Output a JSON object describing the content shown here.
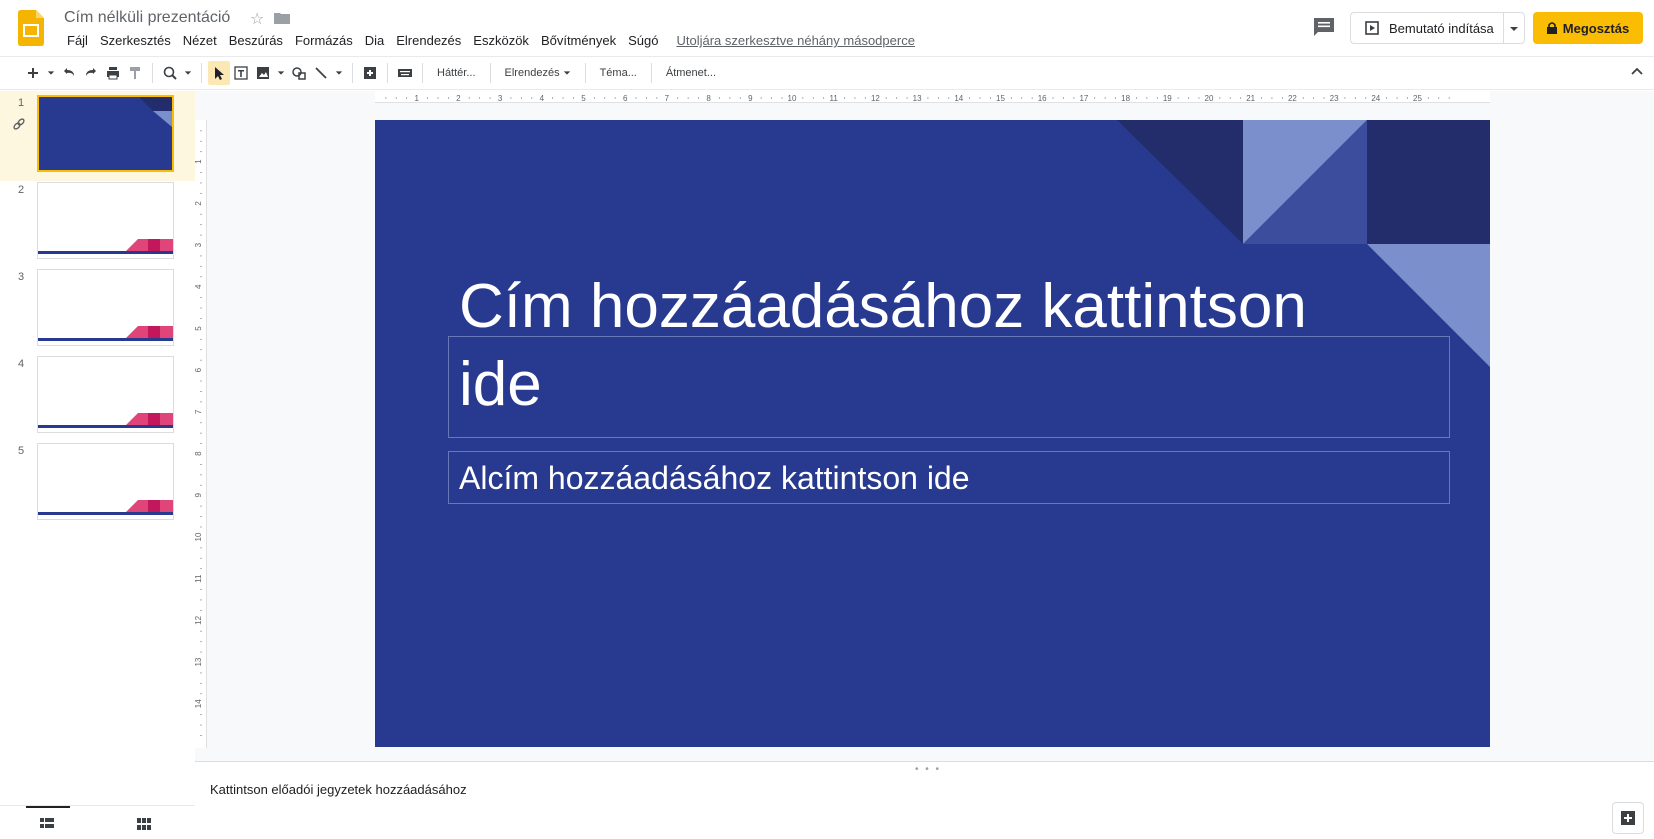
{
  "header": {
    "doc_title": "Cím nélküli prezentáció",
    "menu": [
      "Fájl",
      "Szerkesztés",
      "Nézet",
      "Beszúrás",
      "Formázás",
      "Dia",
      "Elrendezés",
      "Eszközök",
      "Bővítmények",
      "Súgó"
    ],
    "last_edit": "Utoljára szerkesztve néhány másodperce",
    "present_label": "Bemutató indítása",
    "share_label": "Megosztás",
    "accent_color": "#fbbc04"
  },
  "toolbar": {
    "background_label": "Háttér...",
    "layout_label": "Elrendezés",
    "theme_label": "Téma...",
    "transition_label": "Átmenet..."
  },
  "filmstrip": {
    "slides": [
      {
        "number": "1"
      },
      {
        "number": "2"
      },
      {
        "number": "3"
      },
      {
        "number": "4"
      },
      {
        "number": "5"
      }
    ]
  },
  "ruler": {
    "h_ticks": [
      "1",
      "2",
      "3",
      "4",
      "5",
      "6",
      "7",
      "8",
      "9",
      "10",
      "11",
      "12",
      "13",
      "14",
      "15",
      "16",
      "17",
      "18",
      "19",
      "20",
      "21",
      "22",
      "23",
      "24",
      "25"
    ],
    "v_ticks": [
      "1",
      "2",
      "3",
      "4",
      "5",
      "6",
      "7",
      "8",
      "9",
      "10",
      "11",
      "12",
      "13",
      "14"
    ]
  },
  "slide": {
    "title_line1": "Cím hozzáadásához kattintson",
    "title_line2": "ide",
    "subtitle": "Alcím hozzáadásához kattintson ide",
    "background_color": "#283a8f"
  },
  "notes": {
    "placeholder": "Kattintson előadói jegyzetek hozzáadásához"
  }
}
